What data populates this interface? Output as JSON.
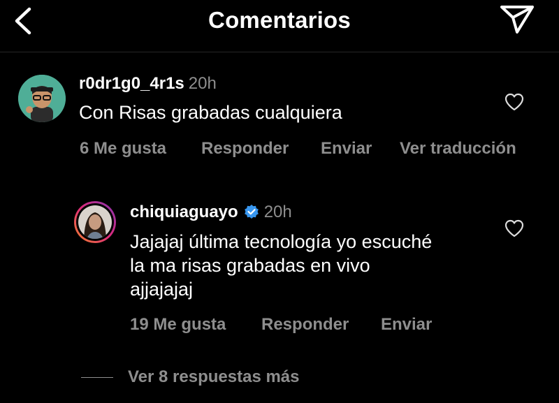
{
  "header": {
    "title": "Comentarios",
    "back_icon": "chevron-left-icon",
    "share_icon": "paper-plane-icon"
  },
  "comment": {
    "username": "r0dr1g0_4r1s",
    "time": "20h",
    "text": "Con Risas grabadas cualquiera",
    "actions": {
      "likes": "6 Me gusta",
      "reply": "Responder",
      "send": "Enviar",
      "translate": "Ver traducción"
    }
  },
  "reply": {
    "username": "chiquiaguayo",
    "verified": true,
    "time": "20h",
    "text_lines": [
      "Jajajaj última tecnología yo escuché",
      "la ma risas grabadas en vivo",
      "ajjajajaj"
    ],
    "actions": {
      "likes": "19 Me gusta",
      "reply": "Responder",
      "send": "Enviar"
    }
  },
  "more_replies": "Ver 8 respuestas más",
  "colors": {
    "background": "#000000",
    "text": "#ffffff",
    "secondary": "#8e8e8e",
    "verified": "#3897f0",
    "story_ring_start": "#f58529",
    "story_ring_end": "#dd2a7b"
  }
}
